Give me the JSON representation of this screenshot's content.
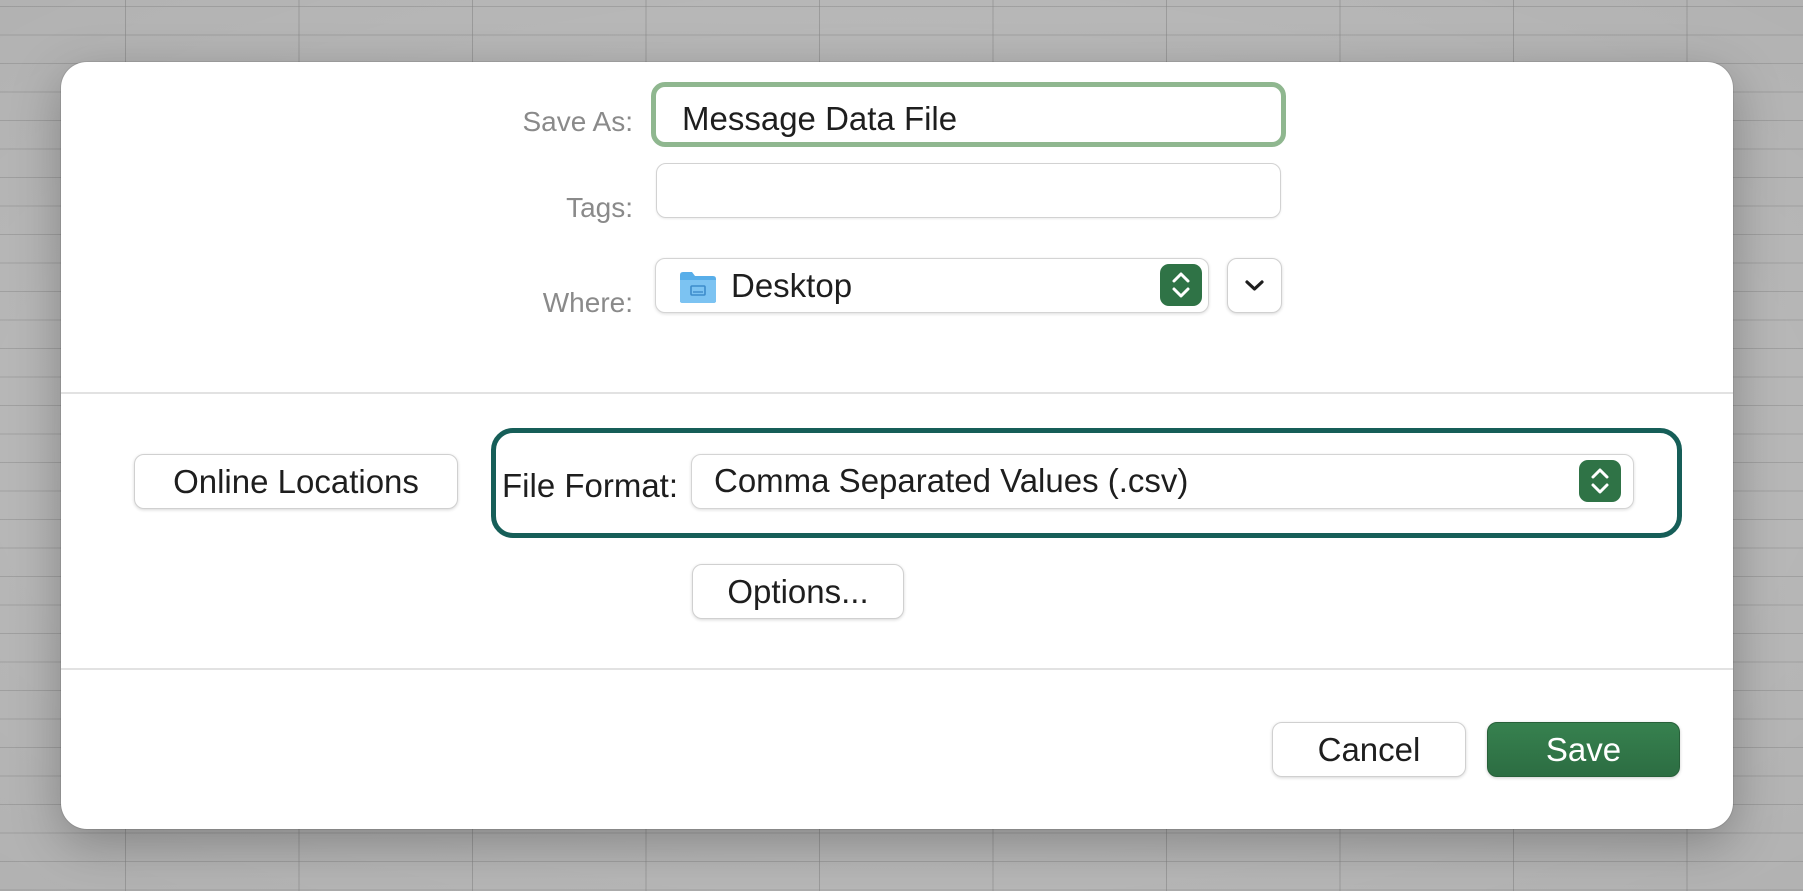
{
  "dialog": {
    "save_as": {
      "label": "Save As:",
      "value": "Message Data File"
    },
    "tags": {
      "label": "Tags:",
      "value": ""
    },
    "where": {
      "label": "Where:",
      "value": "Desktop",
      "icon": "folder-icon",
      "expand_icon": "chevron-down-icon"
    },
    "online_locations_label": "Online Locations",
    "file_format": {
      "label": "File Format:",
      "value": "Comma Separated Values (.csv)"
    },
    "options_label": "Options...",
    "cancel_label": "Cancel",
    "save_label": "Save"
  },
  "colors": {
    "accent_green": "#2f7346",
    "focus_ring": "#8fb78f",
    "highlight_teal": "#165e58"
  }
}
